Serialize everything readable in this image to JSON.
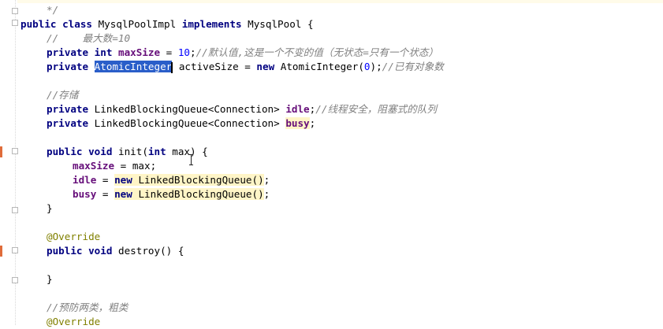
{
  "editor": {
    "language": "java",
    "lines": [
      {
        "indent": 1,
        "tokens": [
          [
            "cm",
            "*/"
          ]
        ]
      },
      {
        "indent": 0,
        "tokens": [
          [
            "kw",
            "public class "
          ],
          [
            "plain",
            "MysqlPoolImpl "
          ],
          [
            "kw",
            "implements "
          ],
          [
            "plain",
            "MysqlPool {"
          ]
        ]
      },
      {
        "indent": 1,
        "tokens": [
          [
            "cm",
            "//    最大数=10"
          ]
        ]
      },
      {
        "indent": 1,
        "tokens": [
          [
            "kw",
            "private int "
          ],
          [
            "fld",
            "maxSize"
          ],
          [
            "plain",
            " = "
          ],
          [
            "num",
            "10"
          ],
          [
            "plain",
            ";"
          ],
          [
            "cm",
            "//默认值,这是一个不变的值（无状态=只有一个状态）"
          ]
        ]
      },
      {
        "indent": 1,
        "tokens": [
          [
            "kw",
            "private "
          ],
          [
            "sel",
            "AtomicInteger"
          ],
          [
            "plain",
            " activeSize = "
          ],
          [
            "kw",
            "new "
          ],
          [
            "plain",
            "AtomicInteger("
          ],
          [
            "num",
            "0"
          ],
          [
            "plain",
            ");"
          ],
          [
            "cm",
            "//已有对象数"
          ]
        ]
      },
      {
        "indent": 0,
        "tokens": []
      },
      {
        "indent": 1,
        "tokens": [
          [
            "cm",
            "//存储"
          ]
        ]
      },
      {
        "indent": 1,
        "tokens": [
          [
            "kw",
            "private "
          ],
          [
            "plain",
            "LinkedBlockingQueue<Connection> "
          ],
          [
            "fld",
            "idle"
          ],
          [
            "plain",
            ";"
          ],
          [
            "cm",
            "//线程安全，阻塞式的队列"
          ]
        ]
      },
      {
        "indent": 1,
        "tokens": [
          [
            "kw",
            "private "
          ],
          [
            "plain",
            "LinkedBlockingQueue<Connection> "
          ],
          [
            "fldhl",
            "busy"
          ],
          [
            "plain",
            ";"
          ]
        ]
      },
      {
        "indent": 0,
        "tokens": []
      },
      {
        "indent": 1,
        "tokens": [
          [
            "kw",
            "public void "
          ],
          [
            "plain",
            "init("
          ],
          [
            "kw",
            "int "
          ],
          [
            "plain",
            "max) {"
          ]
        ]
      },
      {
        "indent": 2,
        "tokens": [
          [
            "fld",
            "maxSize"
          ],
          [
            "plain",
            " = max;"
          ]
        ]
      },
      {
        "indent": 2,
        "tokens": [
          [
            "fld",
            "idle"
          ],
          [
            "plain",
            " = "
          ],
          [
            "kwhl",
            "new "
          ],
          [
            "hl",
            "LinkedBlockingQueue()"
          ],
          [
            "plain",
            ";"
          ]
        ]
      },
      {
        "indent": 2,
        "tokens": [
          [
            "fld",
            "busy"
          ],
          [
            "plain",
            " = "
          ],
          [
            "kwhl",
            "new "
          ],
          [
            "hl",
            "LinkedBlockingQueue()"
          ],
          [
            "plain",
            ";"
          ]
        ]
      },
      {
        "indent": 1,
        "tokens": [
          [
            "plain",
            "}"
          ]
        ]
      },
      {
        "indent": 0,
        "tokens": []
      },
      {
        "indent": 1,
        "tokens": [
          [
            "anno",
            "@Override"
          ]
        ]
      },
      {
        "indent": 1,
        "tokens": [
          [
            "kw",
            "public void "
          ],
          [
            "plain",
            "destroy() {"
          ]
        ]
      },
      {
        "indent": 0,
        "tokens": []
      },
      {
        "indent": 1,
        "tokens": [
          [
            "plain",
            "}"
          ]
        ]
      },
      {
        "indent": 0,
        "tokens": []
      },
      {
        "indent": 1,
        "tokens": [
          [
            "cm",
            "//预防两类，粗类"
          ]
        ]
      },
      {
        "indent": 1,
        "tokens": [
          [
            "anno",
            "@Override"
          ]
        ]
      }
    ]
  },
  "icons": {
    "fold": "fold-marker-icon",
    "change": "change-marker-icon",
    "cursor": "text-cursor-icon"
  }
}
